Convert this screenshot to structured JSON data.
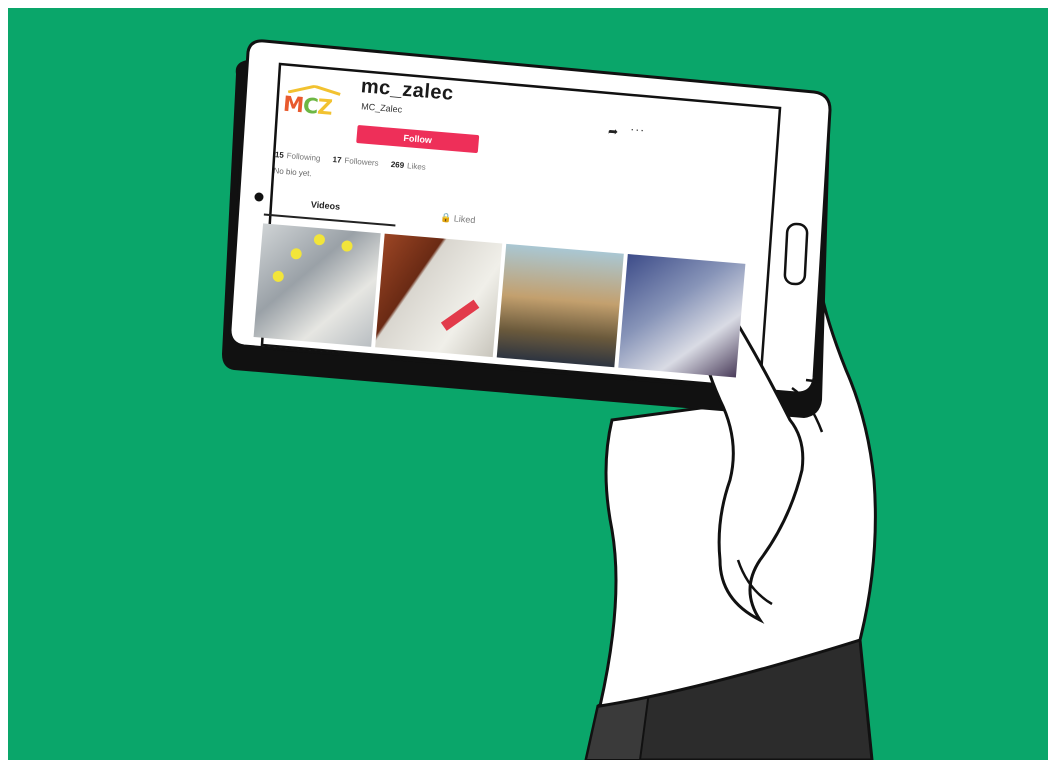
{
  "colors": {
    "background": "#0aa66a",
    "follow_button": "#ee2f59",
    "device_frame": "#ffffff",
    "outline": "#111111"
  },
  "profile": {
    "username": "mc_zalec",
    "handle": "MC_Zalec",
    "follow_label": "Follow",
    "logo_text": "MCZ",
    "stats": {
      "following_count": "15",
      "following_label": "Following",
      "followers_count": "17",
      "followers_label": "Followers",
      "likes_count": "269",
      "likes_label": "Likes"
    },
    "bio": "No bio yet."
  },
  "tabs": {
    "videos": "Videos",
    "liked": "Liked"
  },
  "icons": {
    "share": "share-icon",
    "more": "more-icon",
    "lock": "lock-icon"
  }
}
